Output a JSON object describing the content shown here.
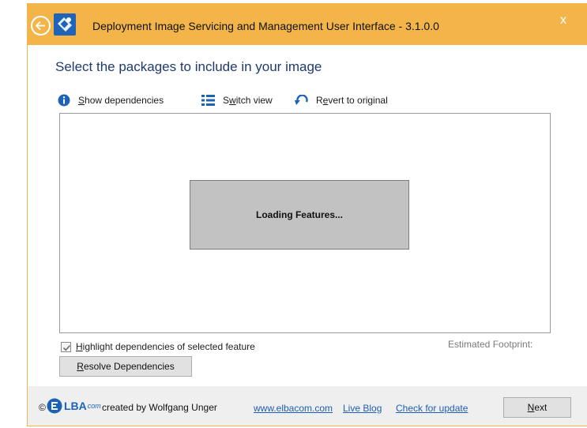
{
  "window": {
    "title": "Deployment Image Servicing and Management User Interface - 3.1.0.0",
    "close_label": "x",
    "accent_color": "#f3b549"
  },
  "heading": "Select the packages to include in your image",
  "toolbar": {
    "show_dependencies": {
      "u": "S",
      "rest": "how dependencies",
      "icon": "info-icon"
    },
    "switch_view": {
      "pre": "S",
      "u": "w",
      "rest": "itch view",
      "icon": "list-view-icon"
    },
    "revert": {
      "pre": "R",
      "u": "e",
      "rest": "vert to original",
      "icon": "undo-icon"
    }
  },
  "panel": {
    "loading_text": "Loading Features..."
  },
  "highlight_checkbox": {
    "u": "H",
    "rest": "ighlight dependencies of selected feature",
    "checked": true
  },
  "estimated_footprint": "Estimated Footprint:",
  "resolve_button": {
    "u": "R",
    "rest": "esolve Dependencies"
  },
  "footer": {
    "copyright": "©",
    "logo_text": "LBA",
    "logo_sub": "com",
    "credit": "created by Wolfgang Unger",
    "links": [
      "www.elbacom.com",
      "Live Blog",
      "Check for update"
    ],
    "next_button": {
      "u": "N",
      "rest": "ext"
    }
  }
}
